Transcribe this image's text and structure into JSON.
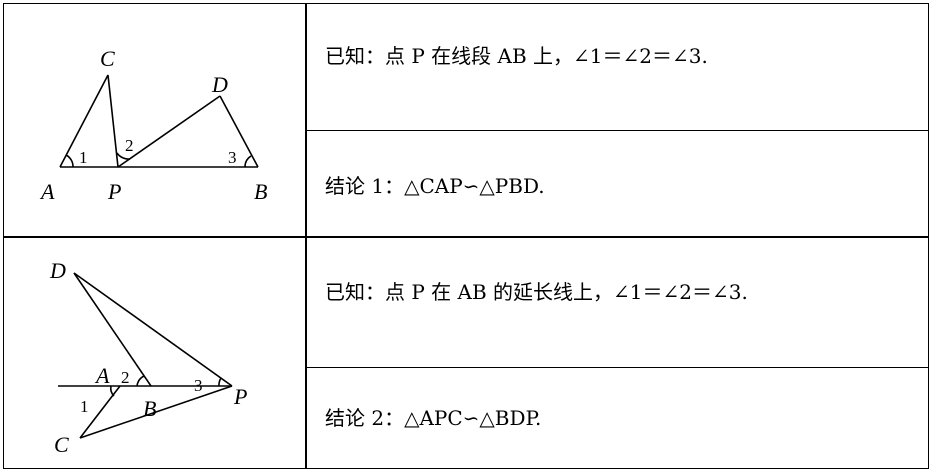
{
  "rows": [
    {
      "given": "已知：点 P 在线段 AB 上，∠1＝∠2＝∠3.",
      "conclusion": "结论 1：△CAP∽△PBD.",
      "figure_labels": {
        "C": "C",
        "D": "D",
        "A": "A",
        "P": "P",
        "B": "B",
        "angle1": "1",
        "angle2": "2",
        "angle3": "3"
      }
    },
    {
      "given": "已知：点 P 在 AB 的延长线上，∠1＝∠2＝∠3.",
      "conclusion": "结论 2：△APC∽△BDP.",
      "figure_labels": {
        "D": "D",
        "A": "A",
        "B": "B",
        "P": "P",
        "C": "C",
        "angle1": "1",
        "angle2": "2",
        "angle3": "3"
      }
    }
  ]
}
